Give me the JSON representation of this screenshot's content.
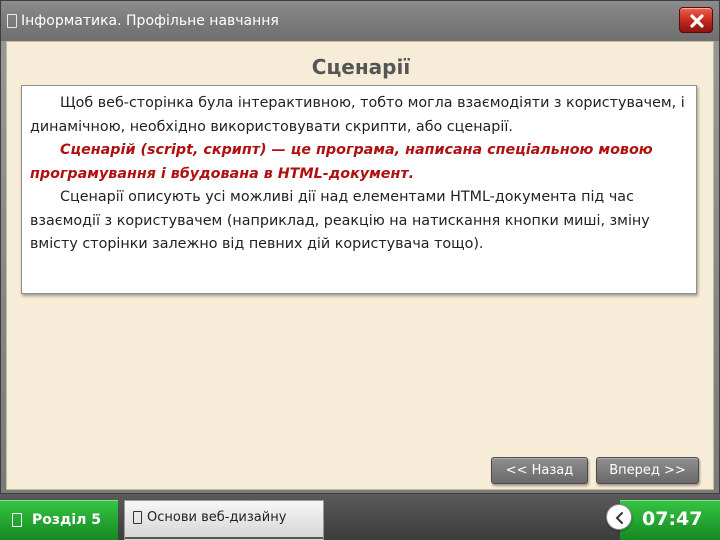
{
  "window": {
    "title": "Інформатика. Профільне навчання",
    "close_icon": "close-x-icon",
    "app_icon": "document-icon"
  },
  "content": {
    "heading": "Сценарії",
    "paragraphs": [
      "Щоб веб-сторінка була інтерактивною, тобто могла взаємодіяти з користувачем, і динамічною, необхідно використовувати скрипти, або сценарії.",
      "Сценарій (script, скрипт) — це програма, написана спеціальною мовою програмування і вбудована в HTML-документ.",
      "Сценарії описують усі можливі дії над елементами HTML-документа під час взаємодії з користувачем (наприклад, реакцію на натискання кнопки миші, зміну вмісту сторінки залежно від певних дій користувача тощо)."
    ]
  },
  "navigation": {
    "back_label": "<< Назад",
    "next_label": "Вперед >>"
  },
  "bottombar": {
    "chapter_label": "Розділ 5",
    "topic_label": "Основи веб-дизайну",
    "timer_value": "07:47",
    "timer_icon": "timer-icon"
  },
  "colors": {
    "panel_background": "#f6ecd8",
    "definition_text": "#b01010",
    "accent_green": "#22a12f",
    "close_red": "#c0281c"
  }
}
